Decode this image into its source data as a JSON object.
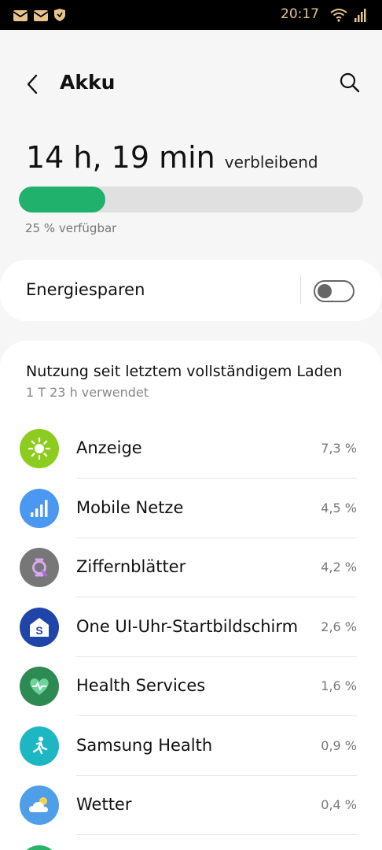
{
  "status_bar": {
    "time": "20:17",
    "left_icons": [
      "mail-icon",
      "mail-icon",
      "shield-icon"
    ],
    "right_icons": [
      "wifi-icon",
      "signal-icon"
    ],
    "accent": "#e7c48c"
  },
  "header": {
    "title": "Akku",
    "back_icon": "back-icon",
    "search_icon": "search-icon"
  },
  "battery": {
    "remaining_time": "14 h, 19 min",
    "remaining_suffix": "verbleibend",
    "available_text": "25 % verfügbar",
    "level": 0.25,
    "bar_color": "#20b26c"
  },
  "power_saving": {
    "label": "Energiesparen",
    "enabled": false
  },
  "usage": {
    "title": "Nutzung seit letztem vollständigem Laden",
    "subtitle": "1 T 23 h verwendet",
    "apps": [
      {
        "name": "Anzeige",
        "percent": "7,3 %",
        "icon": "brightness-icon",
        "color": "#8ccc1e"
      },
      {
        "name": "Mobile Netze",
        "percent": "4,5 %",
        "icon": "signal-bars-icon",
        "color": "#4a98f0"
      },
      {
        "name": "Ziffernblätter",
        "percent": "4,2 %",
        "icon": "watch-face-icon",
        "color": "#777777"
      },
      {
        "name": "One UI-Uhr-Startbildschirm",
        "percent": "2,6 %",
        "icon": "home-s-icon",
        "color": "#1f45a8"
      },
      {
        "name": "Health Services",
        "percent": "1,6 %",
        "icon": "heart-pulse-icon",
        "color": "#2c8a52"
      },
      {
        "name": "Samsung Health",
        "percent": "0,9 %",
        "icon": "runner-icon",
        "color": "#1db7c4"
      },
      {
        "name": "Wetter",
        "percent": "0,4 %",
        "icon": "weather-icon",
        "color": "#4f9fe8"
      }
    ]
  }
}
